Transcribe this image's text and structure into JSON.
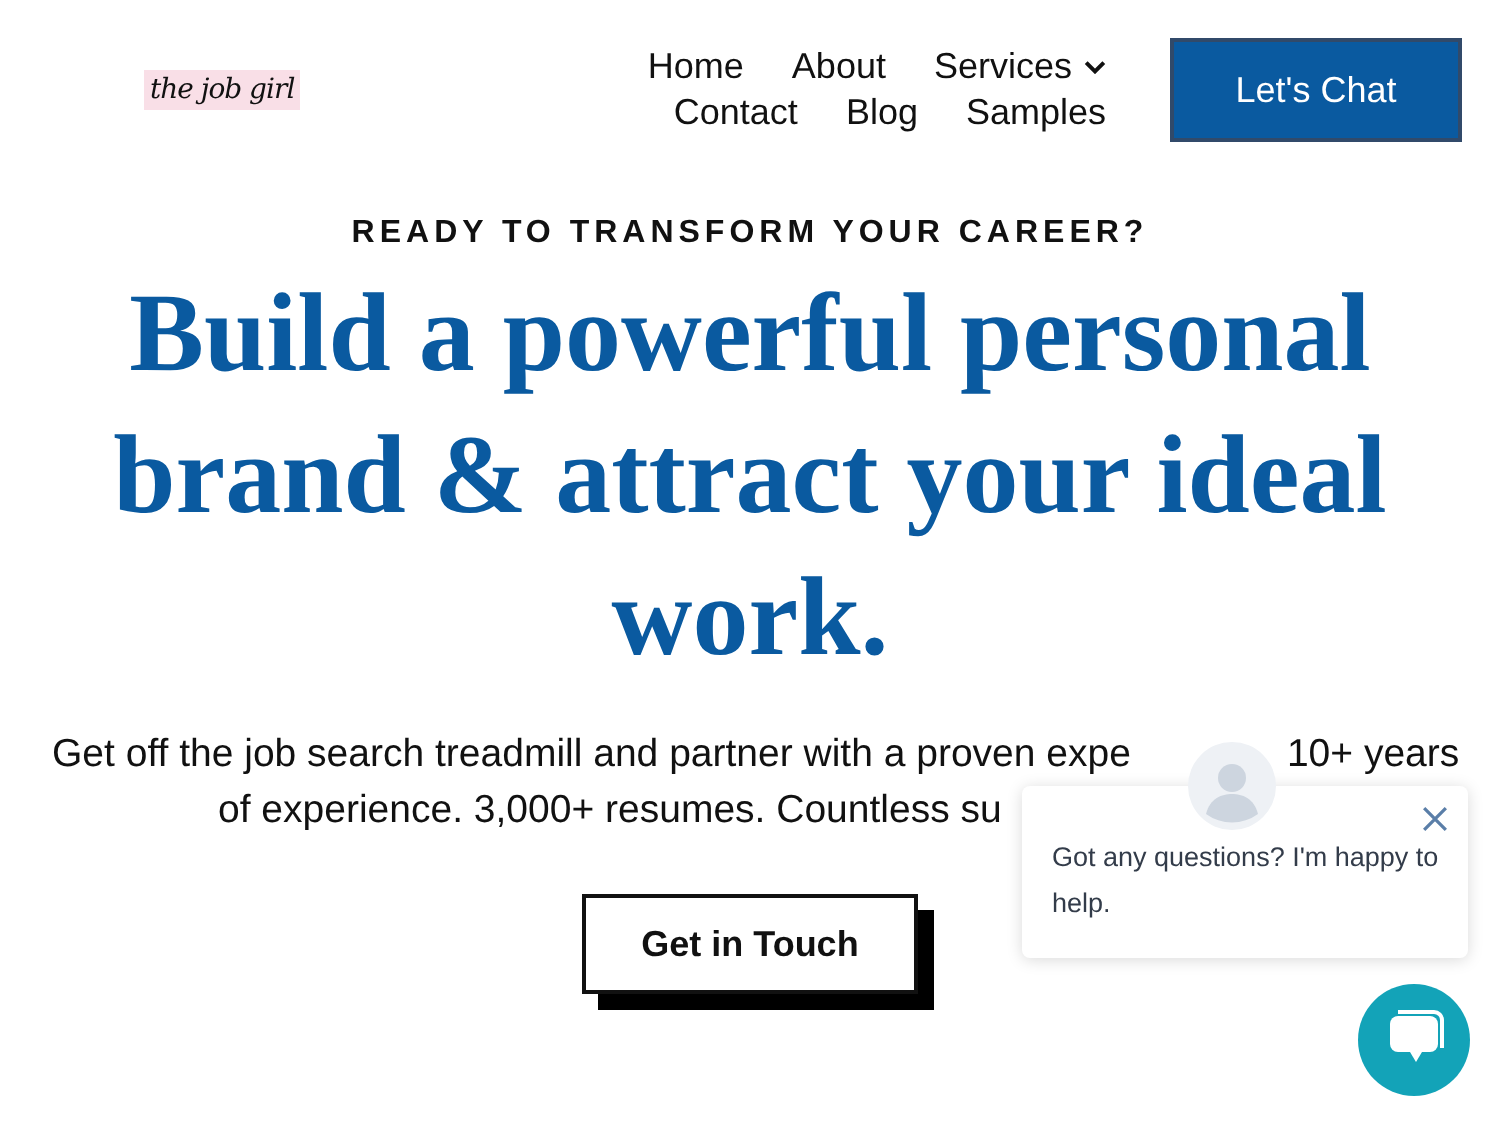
{
  "logo": "the job girl",
  "nav": [
    {
      "label": "Home",
      "has_menu": false
    },
    {
      "label": "About",
      "has_menu": false
    },
    {
      "label": "Services",
      "has_menu": true
    },
    {
      "label": "Contact",
      "has_menu": false
    },
    {
      "label": "Blog",
      "has_menu": false
    },
    {
      "label": "Samples",
      "has_menu": false
    }
  ],
  "cta_button": "Let's Chat",
  "hero": {
    "eyebrow": "READY TO TRANSFORM YOUR CAREER?",
    "headline": "Build a powerful personal brand & attract your ideal work.",
    "intro_lines": [
      [
        "Get off the job search treadmill and partner with a proven expe",
        "10+ years"
      ],
      [
        "of experience. 3,000+ resumes. Countless su"
      ]
    ],
    "button": "Get in Touch"
  },
  "chat": {
    "message": "Got any questions? I'm happy to help."
  }
}
